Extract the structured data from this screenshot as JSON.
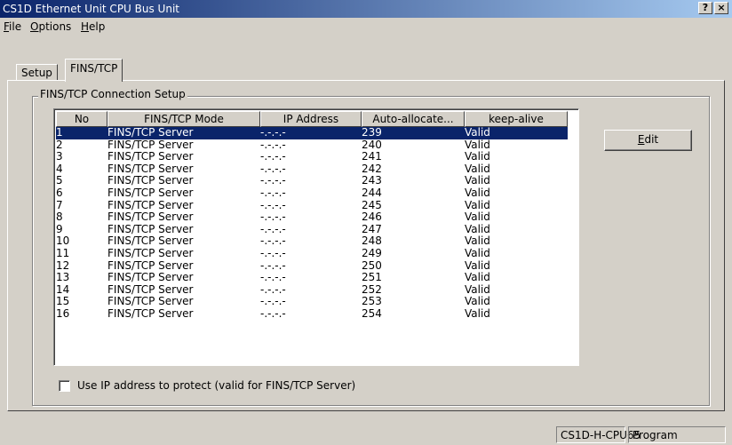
{
  "window": {
    "title": "CS1D Ethernet Unit CPU Bus Unit",
    "help_btn": "?",
    "close_btn": "×"
  },
  "menu": [
    {
      "key": "F",
      "rest": "ile"
    },
    {
      "key": "O",
      "rest": "ptions"
    },
    {
      "key": "H",
      "rest": "elp"
    }
  ],
  "tabs": [
    "Setup",
    "FINS/TCP"
  ],
  "group": {
    "label": "FINS/TCP Connection Setup"
  },
  "table": {
    "columns": [
      "No",
      "FINS/TCP Mode",
      "IP Address",
      "Auto-allocate...",
      "keep-alive"
    ],
    "rows": [
      [
        "1",
        "FINS/TCP Server",
        "-.-.-.-",
        "239",
        "Valid"
      ],
      [
        "2",
        "FINS/TCP Server",
        "-.-.-.-",
        "240",
        "Valid"
      ],
      [
        "3",
        "FINS/TCP Server",
        "-.-.-.-",
        "241",
        "Valid"
      ],
      [
        "4",
        "FINS/TCP Server",
        "-.-.-.-",
        "242",
        "Valid"
      ],
      [
        "5",
        "FINS/TCP Server",
        "-.-.-.-",
        "243",
        "Valid"
      ],
      [
        "6",
        "FINS/TCP Server",
        "-.-.-.-",
        "244",
        "Valid"
      ],
      [
        "7",
        "FINS/TCP Server",
        "-.-.-.-",
        "245",
        "Valid"
      ],
      [
        "8",
        "FINS/TCP Server",
        "-.-.-.-",
        "246",
        "Valid"
      ],
      [
        "9",
        "FINS/TCP Server",
        "-.-.-.-",
        "247",
        "Valid"
      ],
      [
        "10",
        "FINS/TCP Server",
        "-.-.-.-",
        "248",
        "Valid"
      ],
      [
        "11",
        "FINS/TCP Server",
        "-.-.-.-",
        "249",
        "Valid"
      ],
      [
        "12",
        "FINS/TCP Server",
        "-.-.-.-",
        "250",
        "Valid"
      ],
      [
        "13",
        "FINS/TCP Server",
        "-.-.-.-",
        "251",
        "Valid"
      ],
      [
        "14",
        "FINS/TCP Server",
        "-.-.-.-",
        "252",
        "Valid"
      ],
      [
        "15",
        "FINS/TCP Server",
        "-.-.-.-",
        "253",
        "Valid"
      ],
      [
        "16",
        "FINS/TCP Server",
        "-.-.-.-",
        "254",
        "Valid"
      ]
    ],
    "selected_row": 0
  },
  "edit_button": {
    "key": "E",
    "rest": "dit"
  },
  "protect_checkbox": {
    "label": "Use IP address to protect (valid for FINS/TCP Server)",
    "checked": false
  },
  "status": {
    "cpu": "CS1D-H-CPU65",
    "mode": "Program"
  },
  "colors": {
    "title_start": "#0a246a",
    "title_end": "#a6caf0",
    "selection": "#0a246a",
    "face": "#d4d0c8"
  }
}
